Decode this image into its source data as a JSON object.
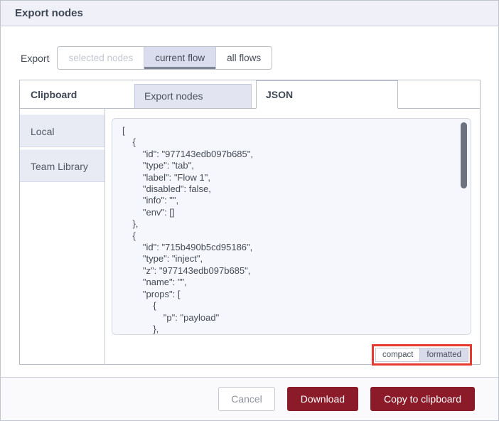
{
  "dialog": {
    "title": "Export nodes",
    "export_label": "Export",
    "scope_buttons": {
      "selected_nodes": "selected nodes",
      "current_flow": "current flow",
      "all_flows": "all flows"
    },
    "destination_tabs": {
      "clipboard": "Clipboard",
      "local": "Local",
      "team_library": "Team Library"
    },
    "content_tabs": {
      "export_nodes": "Export nodes",
      "json": "JSON"
    },
    "editor": {
      "content": "[\n    {\n        \"id\": \"977143edb097b685\",\n        \"type\": \"tab\",\n        \"label\": \"Flow 1\",\n        \"disabled\": false,\n        \"info\": \"\",\n        \"env\": []\n    },\n    {\n        \"id\": \"715b490b5cd95186\",\n        \"type\": \"inject\",\n        \"z\": \"977143edb097b685\",\n        \"name\": \"\",\n        \"props\": [\n            {\n                \"p\": \"payload\"\n            },"
    },
    "format_toggle": {
      "compact": "compact",
      "formatted": "formatted"
    },
    "footer": {
      "cancel": "Cancel",
      "download": "Download",
      "copy": "Copy to clipboard"
    },
    "colors": {
      "primary_button": "#8C1B2A",
      "annotation_highlight": "#E6392F",
      "titlebar_bg": "#EFF0F8",
      "inactive_tab_bg": "#E2E4F1",
      "selected_scope_bg": "#DADDED",
      "editor_bg": "#F6F7FC"
    }
  }
}
